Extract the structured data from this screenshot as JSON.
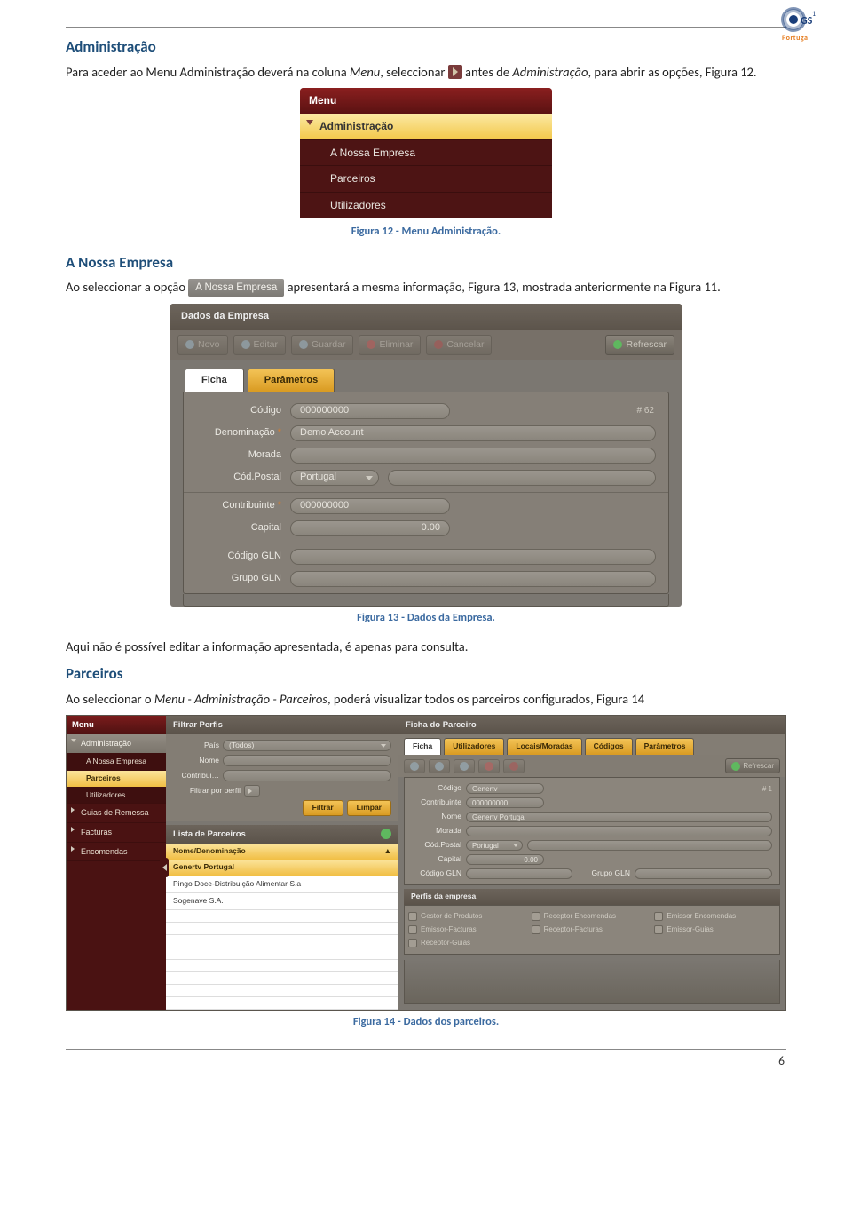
{
  "doc": {
    "logo_label": "GS1",
    "logo_sub": "Portugal",
    "page_number": "6",
    "section_admin": "Administração",
    "p_admin_1a": "Para aceder ao Menu Administração deverá na coluna ",
    "p_admin_1b": "Menu",
    "p_admin_1c": ", seleccionar ",
    "p_admin_1d": " antes de ",
    "p_admin_1e": "Administração",
    "p_admin_1f": ", para abrir as opções, Figura 12.",
    "caption12": "Figura 12 - Menu Administração.",
    "section_anossa": "A Nossa Empresa",
    "p_anossa_a": "Ao seleccionar a opção ",
    "chip_anp": "A Nossa Empresa",
    "p_anossa_b": " apresentará a mesma informação, Figura 13, mostrada anteriormente na Figura 11.",
    "caption13": "Figura 13 - Dados da Empresa.",
    "p_noedit": "Aqui não é possível editar a informação apresentada, é apenas para consulta.",
    "section_parc": "Parceiros",
    "p_parc_a": "Ao seleccionar o ",
    "p_parc_b": "Menu - Administração - Parceiros",
    "p_parc_c": ", poderá visualizar todos os parceiros configurados, Figura 14",
    "caption14": "Figura 14 - Dados dos parceiros."
  },
  "menu": {
    "title": "Menu",
    "expanded": "Administração",
    "items": [
      "A Nossa Empresa",
      "Parceiros",
      "Utilizadores"
    ]
  },
  "empresa": {
    "panel": "Dados da Empresa",
    "toolbar": {
      "novo": "Novo",
      "editar": "Editar",
      "guardar": "Guardar",
      "eliminar": "Eliminar",
      "cancelar": "Cancelar",
      "refrescar": "Refrescar"
    },
    "tabs": {
      "ficha": "Ficha",
      "param": "Parâmetros"
    },
    "rows": {
      "codigo_lab": "Código",
      "codigo_val": "000000000",
      "hash": "# 62",
      "denom_lab": "Denominação",
      "denom_val": "Demo Account",
      "morada_lab": "Morada",
      "morada_val": "",
      "codpostal_lab": "Cód.Postal",
      "codpostal_val": "Portugal",
      "contrib_lab": "Contribuinte",
      "contrib_val": "000000000",
      "capital_lab": "Capital",
      "capital_val": "0.00",
      "codgln_lab": "Código GLN",
      "codgln_val": "",
      "grupogln_lab": "Grupo GLN",
      "grupogln_val": ""
    }
  },
  "parc": {
    "leftmenu": {
      "title": "Menu",
      "admin": "Administração",
      "subs": [
        "A Nossa Empresa",
        "Parceiros",
        "Utilizadores"
      ],
      "others": [
        "Guias de Remessa",
        "Facturas",
        "Encomendas"
      ]
    },
    "filter": {
      "title": "Filtrar Perfis",
      "pais_lab": "País",
      "pais_val": "(Todos)",
      "nome_lab": "Nome",
      "contrib_lab": "Contribui…",
      "filtra_lab": "Filtrar por perfil",
      "btn_filtrar": "Filtrar",
      "btn_limpar": "Limpar"
    },
    "list": {
      "title": "Lista de Parceiros",
      "col": "Nome/Denominação",
      "rows": [
        "Genertv Portugal",
        "Pingo Doce-Distribuição Alimentar S.a",
        "Sogenave S.A."
      ]
    },
    "ficha": {
      "title": "Ficha do Parceiro",
      "tabs": [
        "Ficha",
        "Utilizadores",
        "Locais/Moradas",
        "Códigos",
        "Parâmetros"
      ],
      "toolbar_refrescar": "Refrescar",
      "codigo_lab": "Código",
      "codigo_val": "Genertv",
      "contrib_lab": "Contribuinte",
      "contrib_val": "000000000",
      "nome_lab": "Nome",
      "nome_val": "Genertv Portugal",
      "morada_lab": "Morada",
      "codpostal_lab": "Cód.Postal",
      "codpostal_val": "Portugal",
      "capital_lab": "Capital",
      "capital_val": "0.00",
      "codgln_lab": "Código GLN",
      "grupogln_lab": "Grupo GLN",
      "hash": "# 1",
      "perfis_title": "Perfis da empresa",
      "perfis": [
        "Gestor de Produtos",
        "Receptor Encomendas",
        "Emissor Encomendas",
        "Emissor-Facturas",
        "Receptor-Facturas",
        "Emissor-Guias",
        "Receptor-Guias"
      ]
    }
  }
}
